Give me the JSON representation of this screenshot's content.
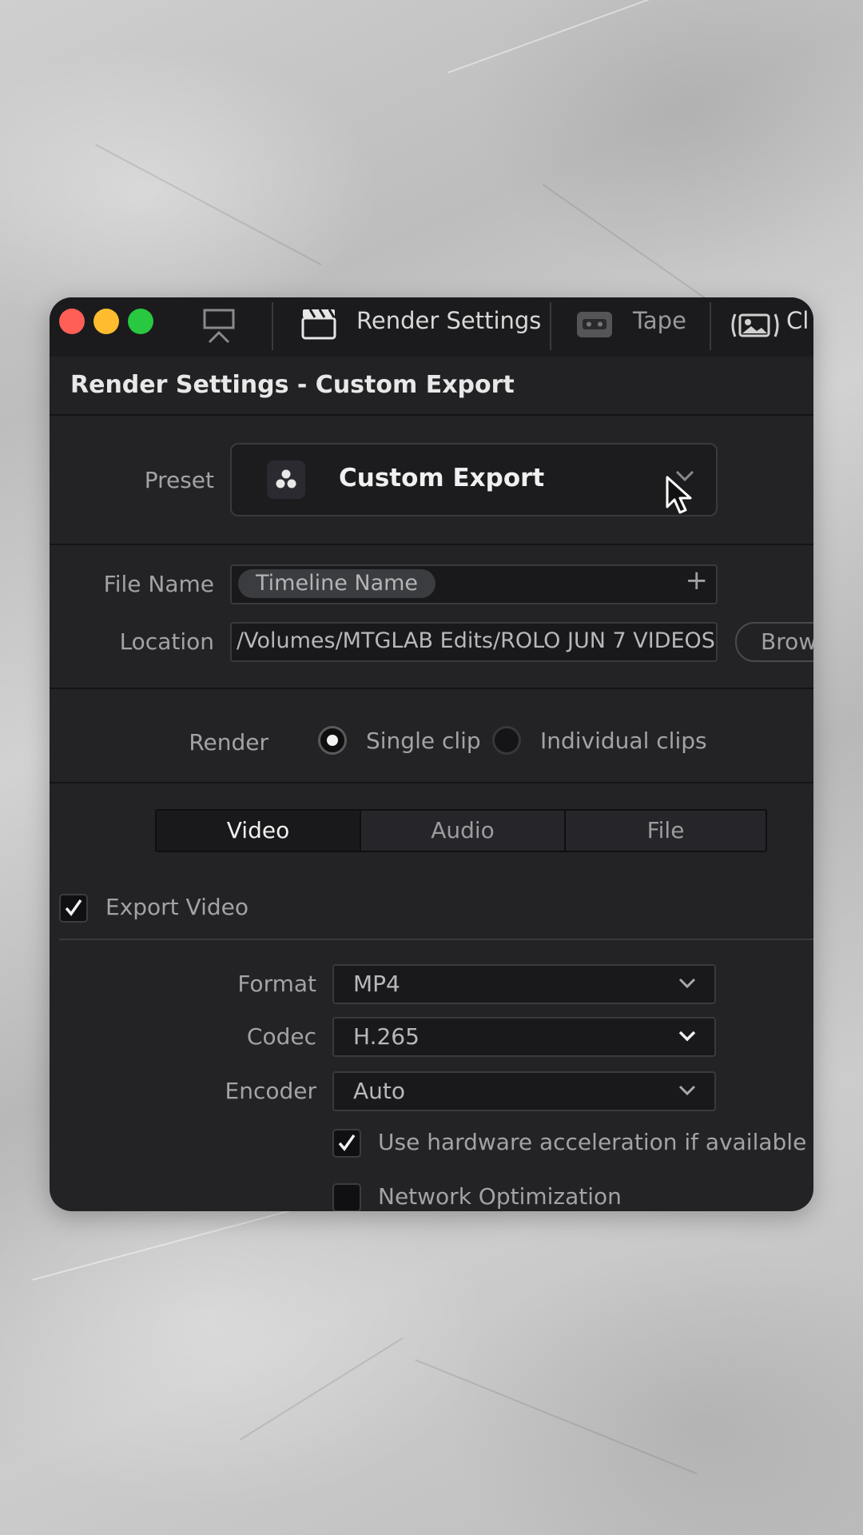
{
  "titlebar": {
    "tabs": [
      {
        "label": "Render Settings",
        "icon": "clapperboard-icon"
      },
      {
        "label": "Tape",
        "icon": "tape-icon"
      },
      {
        "label": "Cl",
        "icon": "clip-icon"
      }
    ],
    "left_icon": "presentation-icon",
    "traffic_lights": [
      "#ff5f57",
      "#febc2e",
      "#28c840"
    ]
  },
  "panel": {
    "title": "Render Settings - Custom Export"
  },
  "preset": {
    "label": "Preset",
    "value": "Custom Export"
  },
  "file": {
    "name_label": "File Name",
    "name_chip": "Timeline Name",
    "add_symbol": "+",
    "location_label": "Location",
    "location_value": "/Volumes/MTGLAB Edits/ROLO JUN 7 VIDEOS",
    "browse_label": "Browse"
  },
  "render": {
    "label": "Render",
    "options": [
      {
        "label": "Single clip",
        "selected": true
      },
      {
        "label": "Individual clips",
        "selected": false
      }
    ]
  },
  "tabs": [
    {
      "label": "Video",
      "active": true
    },
    {
      "label": "Audio",
      "active": false
    },
    {
      "label": "File",
      "active": false
    }
  ],
  "export_video": {
    "label": "Export Video",
    "checked": true
  },
  "format": {
    "label": "Format",
    "value": "MP4"
  },
  "codec": {
    "label": "Codec",
    "value": "H.265"
  },
  "encoder": {
    "label": "Encoder",
    "value": "Auto"
  },
  "options": {
    "hw_accel": {
      "label": "Use hardware acceleration if available",
      "checked": true
    },
    "network_opt": {
      "label": "Network Optimization",
      "checked": false
    }
  }
}
